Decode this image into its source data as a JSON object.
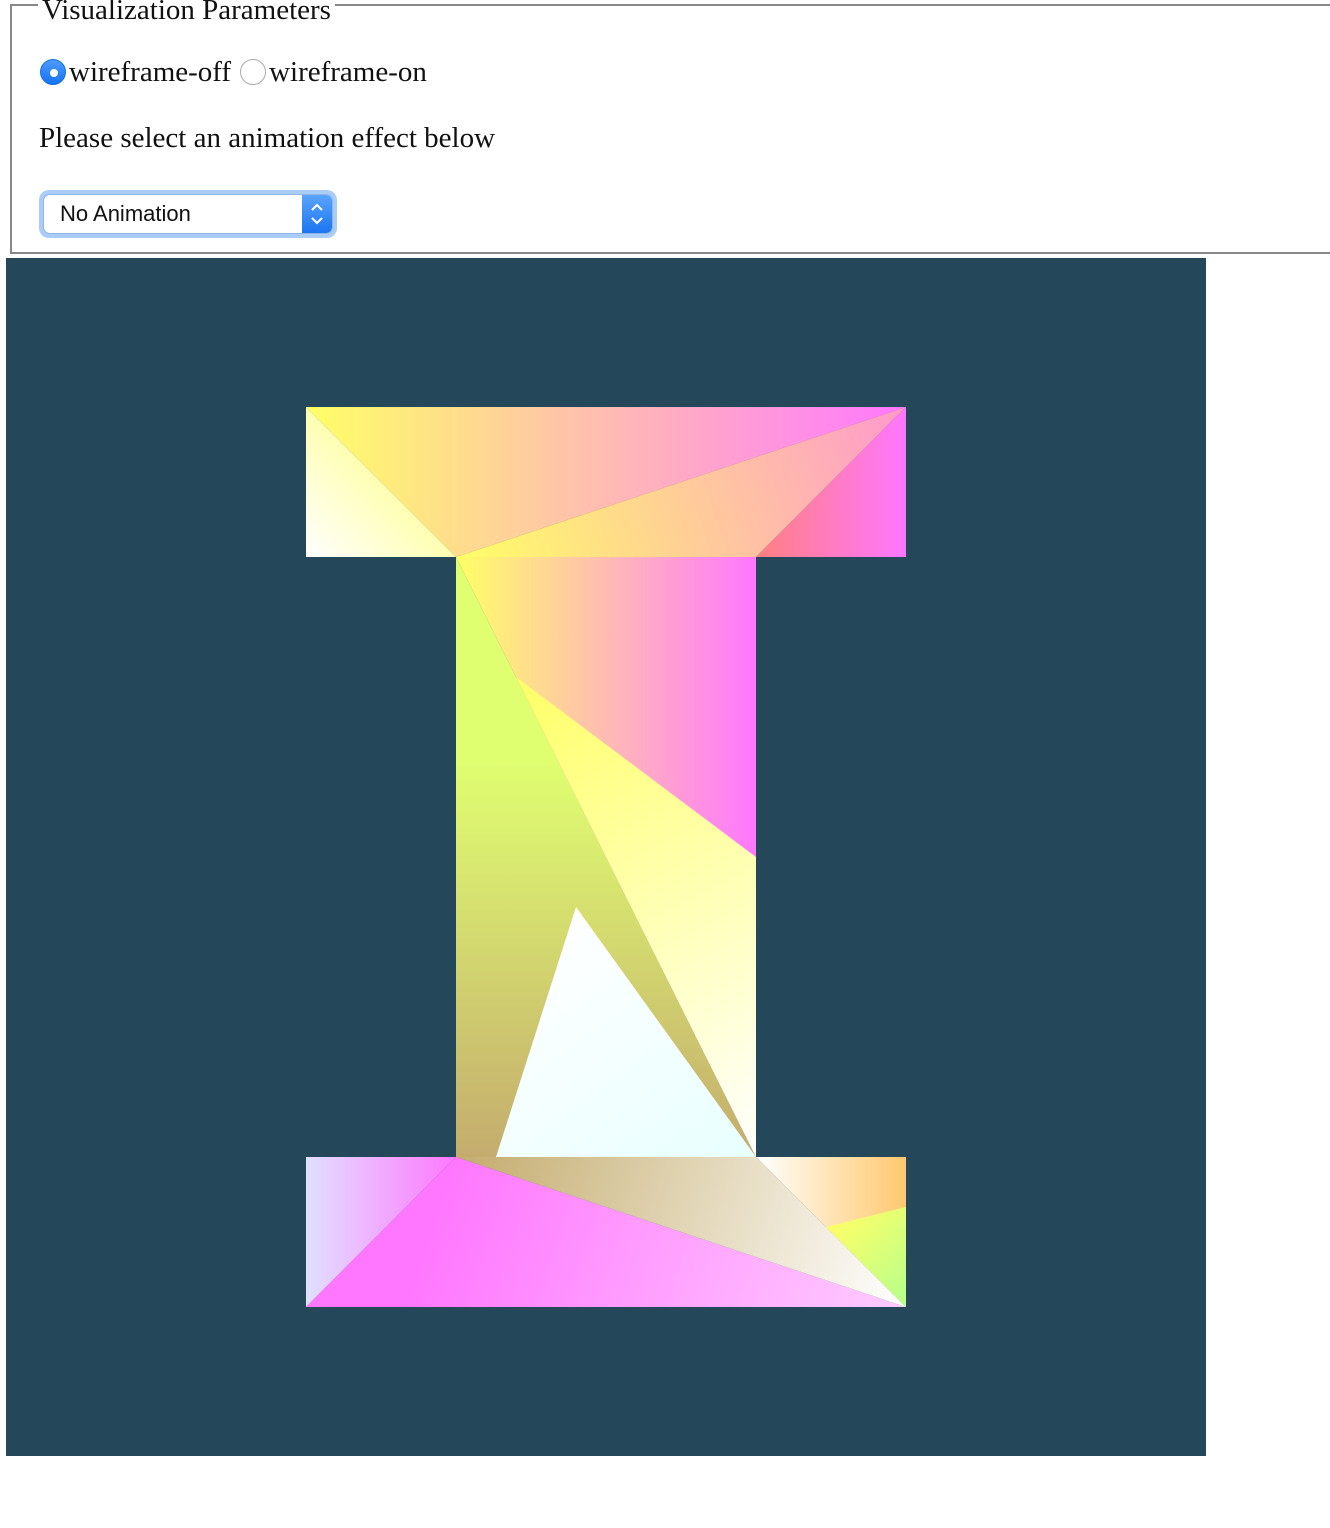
{
  "controls": {
    "legend": "Visualization Parameters",
    "radio_options": [
      {
        "label": "wireframe-off",
        "checked": true
      },
      {
        "label": "wireframe-on",
        "checked": false
      }
    ],
    "prompt": "Please select an animation effect below",
    "animation_select": {
      "selected": "No Animation"
    }
  },
  "canvas": {
    "background_color": "#24475a",
    "shape": "letter I, gradient-colored triangles",
    "palette": {
      "white": "#ffffff",
      "yellow": "#ffff66",
      "magenta": "#ff77ff",
      "pink": "#ff99cc",
      "light_pink": "#ffccff",
      "olive": "#c4ac6e",
      "lime": "#e0ff70",
      "cyan": "#e8ffff",
      "orange": "#ffc86e",
      "green": "#b4ff8c",
      "lavender": "#e0e0ff",
      "salmon": "#ff8080"
    }
  }
}
